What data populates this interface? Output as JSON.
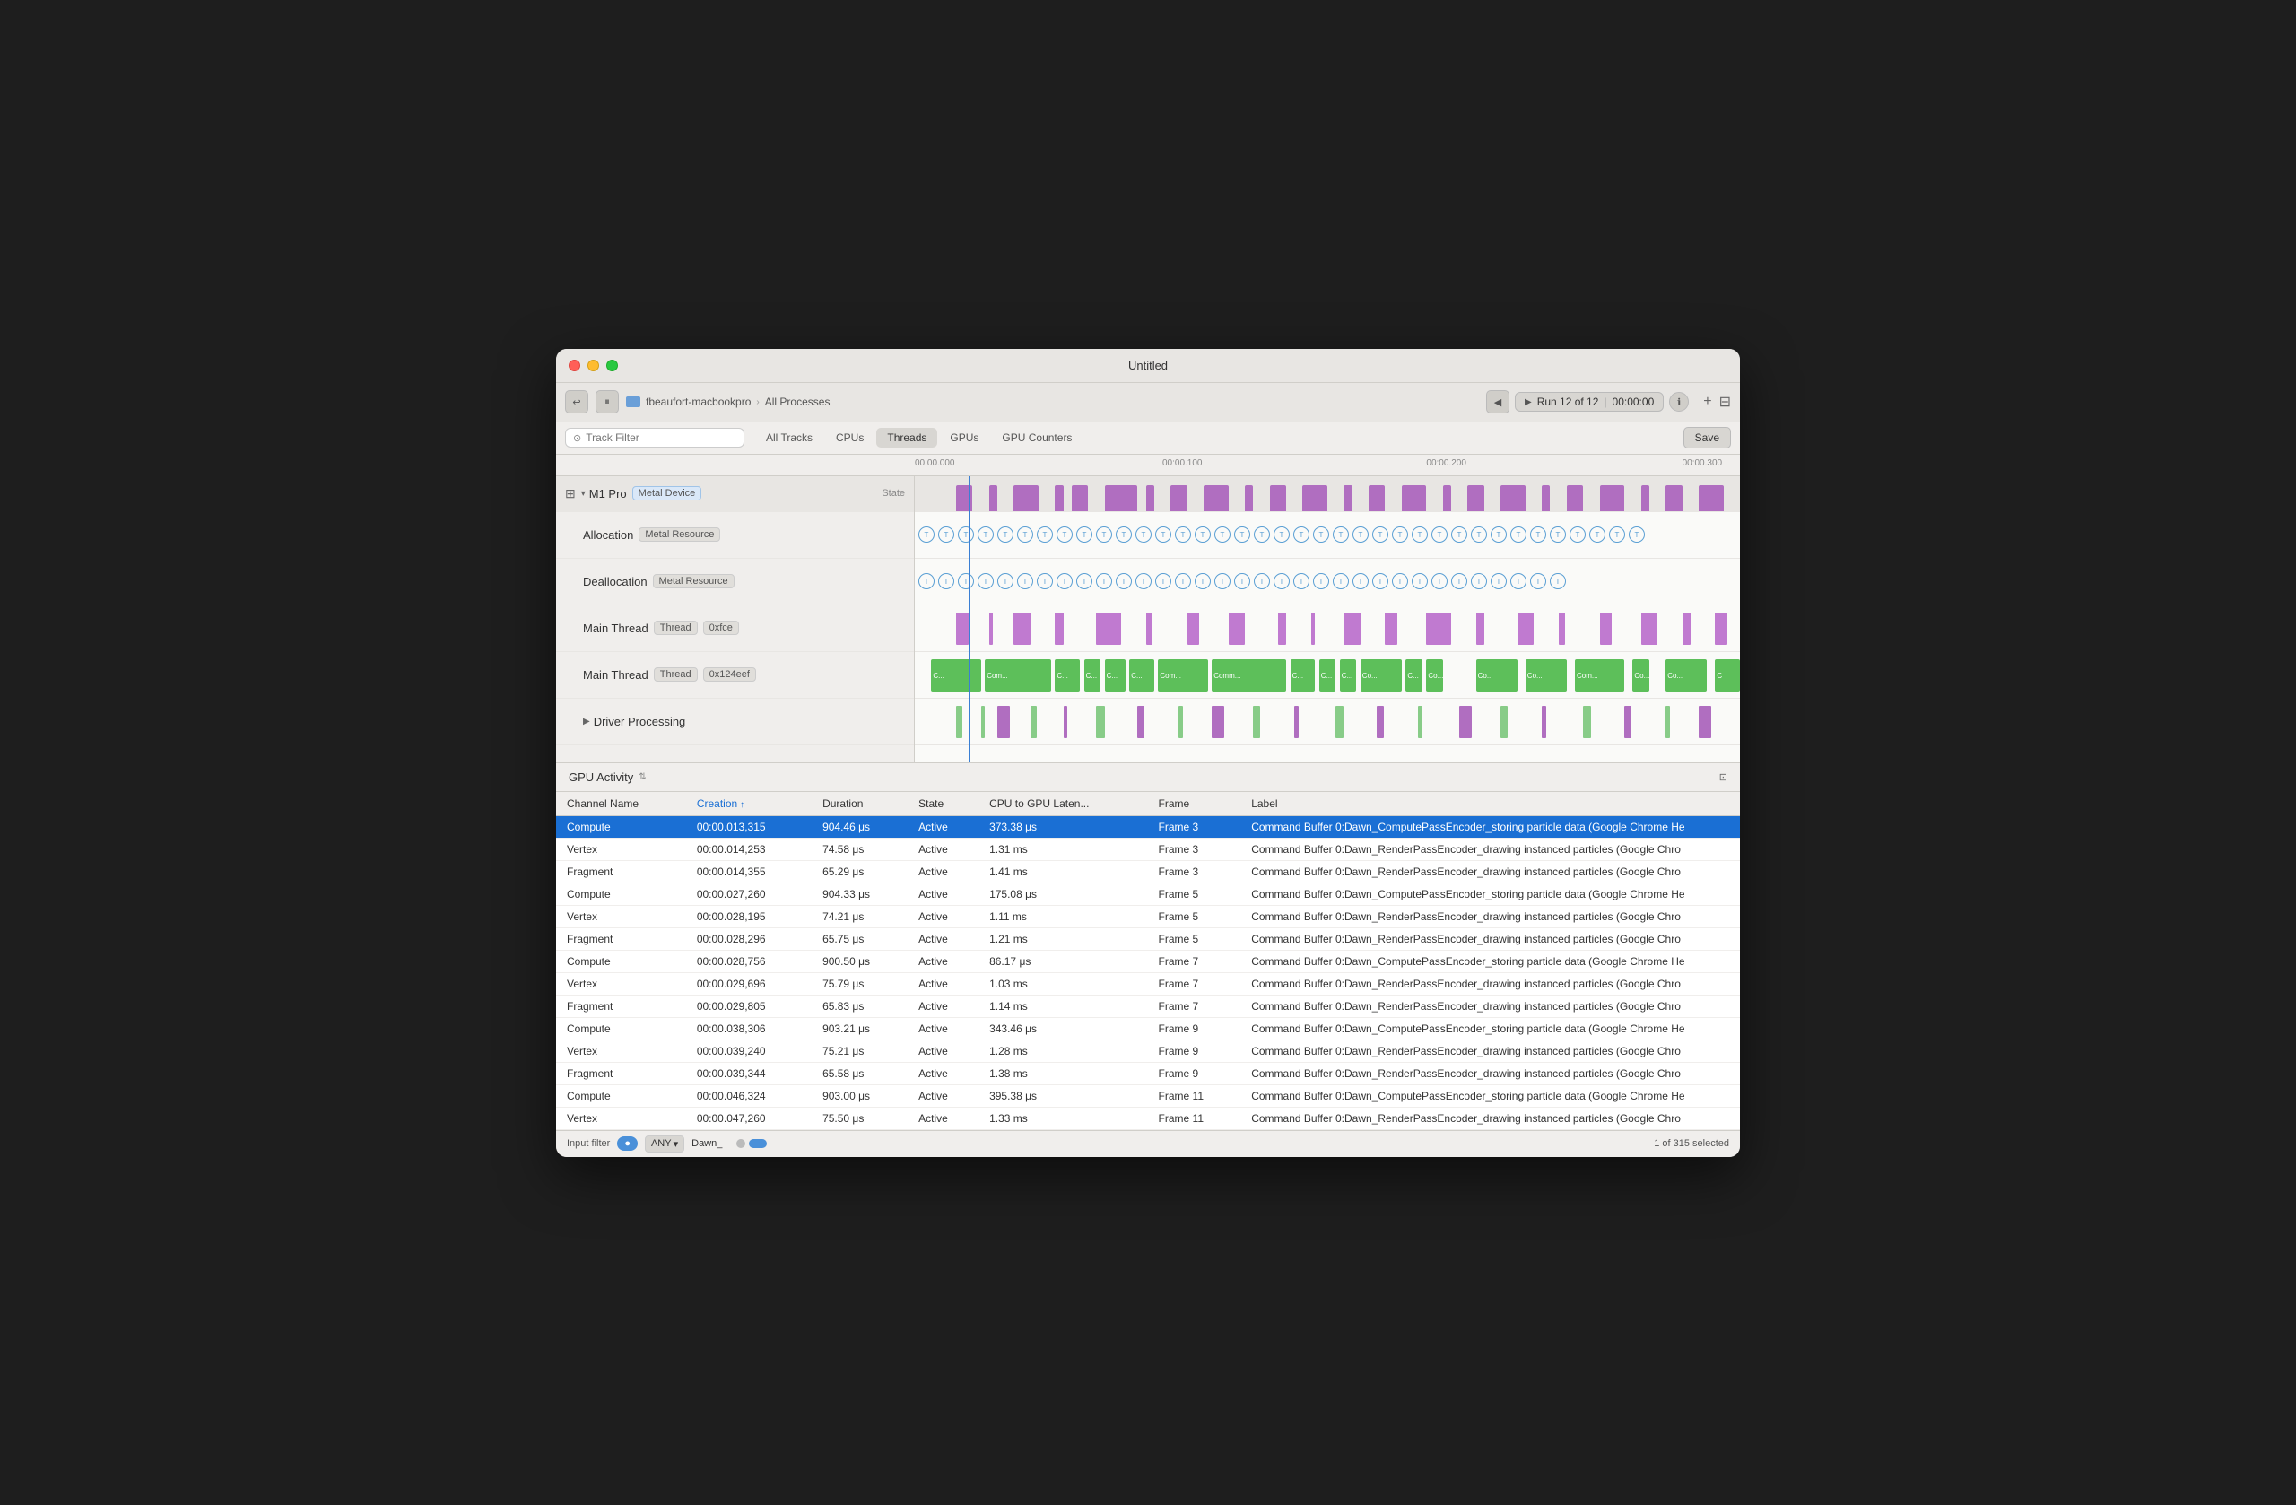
{
  "window": {
    "title": "Untitled"
  },
  "toolbar": {
    "device": "fbeaufort-macbookpro",
    "breadcrumb": "All Processes",
    "run_label": "Run 12 of 12",
    "run_time": "00:00:00",
    "save_label": "Save"
  },
  "tabs": {
    "track_filter_placeholder": "Track Filter",
    "items": [
      {
        "id": "all-tracks",
        "label": "All Tracks",
        "active": false
      },
      {
        "id": "cpus",
        "label": "CPUs",
        "active": false
      },
      {
        "id": "threads",
        "label": "Threads",
        "active": true
      },
      {
        "id": "gpus",
        "label": "GPUs",
        "active": false
      },
      {
        "id": "gpu-counters",
        "label": "GPU Counters",
        "active": false
      }
    ]
  },
  "timeline": {
    "marks": [
      {
        "label": "00:00.000",
        "pos": 0
      },
      {
        "label": "00:00.100",
        "pos": 33
      },
      {
        "label": "00:00.200",
        "pos": 66
      },
      {
        "label": "00:00.300",
        "pos": 96
      }
    ]
  },
  "tracks": [
    {
      "id": "m1-pro",
      "name": "M1 Pro",
      "type": "header",
      "badge": "Metal Device",
      "badge_type": "blue",
      "state_label": "State",
      "viz_type": "purple_blocks"
    },
    {
      "id": "allocation",
      "name": "Allocation",
      "type": "sub",
      "badge": "Metal Resource",
      "viz_type": "circles"
    },
    {
      "id": "deallocation",
      "name": "Deallocation",
      "type": "sub",
      "badge": "Metal Resource",
      "viz_type": "circles"
    },
    {
      "id": "main-thread-1",
      "name": "Main Thread",
      "type": "sub",
      "badge": "Thread",
      "badge2": "0xfce",
      "viz_type": "purple_bars"
    },
    {
      "id": "main-thread-2",
      "name": "Main Thread",
      "type": "sub",
      "badge": "Thread",
      "badge2": "0x124eef",
      "viz_type": "green_bar"
    },
    {
      "id": "driver-processing",
      "name": "Driver Processing",
      "type": "sub",
      "viz_type": "mixed_bars"
    }
  ],
  "gpu_activity": {
    "title": "GPU Activity",
    "columns": [
      {
        "id": "channel",
        "label": "Channel Name"
      },
      {
        "id": "creation",
        "label": "Creation",
        "sorted": true
      },
      {
        "id": "duration",
        "label": "Duration"
      },
      {
        "id": "state",
        "label": "State"
      },
      {
        "id": "cpu_gpu_latency",
        "label": "CPU to GPU Laten..."
      },
      {
        "id": "frame",
        "label": "Frame"
      },
      {
        "id": "label",
        "label": "Label"
      }
    ],
    "rows": [
      {
        "channel": "Compute",
        "creation": "00:00.013,315",
        "duration": "904.46 μs",
        "state": "Active",
        "latency": "373.38 μs",
        "frame": "Frame 3",
        "label": "Command Buffer 0:Dawn_ComputePassEncoder_storing particle data   (Google Chrome He",
        "selected": true
      },
      {
        "channel": "Vertex",
        "creation": "00:00.014,253",
        "duration": "74.58 μs",
        "state": "Active",
        "latency": "1.31 ms",
        "frame": "Frame 3",
        "label": "Command Buffer 0:Dawn_RenderPassEncoder_drawing instanced particles   (Google Chro"
      },
      {
        "channel": "Fragment",
        "creation": "00:00.014,355",
        "duration": "65.29 μs",
        "state": "Active",
        "latency": "1.41 ms",
        "frame": "Frame 3",
        "label": "Command Buffer 0:Dawn_RenderPassEncoder_drawing instanced particles   (Google Chro"
      },
      {
        "channel": "Compute",
        "creation": "00:00.027,260",
        "duration": "904.33 μs",
        "state": "Active",
        "latency": "175.08 μs",
        "frame": "Frame 5",
        "label": "Command Buffer 0:Dawn_ComputePassEncoder_storing particle data   (Google Chrome He"
      },
      {
        "channel": "Vertex",
        "creation": "00:00.028,195",
        "duration": "74.21 μs",
        "state": "Active",
        "latency": "1.11 ms",
        "frame": "Frame 5",
        "label": "Command Buffer 0:Dawn_RenderPassEncoder_drawing instanced particles   (Google Chro"
      },
      {
        "channel": "Fragment",
        "creation": "00:00.028,296",
        "duration": "65.75 μs",
        "state": "Active",
        "latency": "1.21 ms",
        "frame": "Frame 5",
        "label": "Command Buffer 0:Dawn_RenderPassEncoder_drawing instanced particles   (Google Chro"
      },
      {
        "channel": "Compute",
        "creation": "00:00.028,756",
        "duration": "900.50 μs",
        "state": "Active",
        "latency": "86.17 μs",
        "frame": "Frame 7",
        "label": "Command Buffer 0:Dawn_ComputePassEncoder_storing particle data   (Google Chrome He"
      },
      {
        "channel": "Vertex",
        "creation": "00:00.029,696",
        "duration": "75.79 μs",
        "state": "Active",
        "latency": "1.03 ms",
        "frame": "Frame 7",
        "label": "Command Buffer 0:Dawn_RenderPassEncoder_drawing instanced particles   (Google Chro"
      },
      {
        "channel": "Fragment",
        "creation": "00:00.029,805",
        "duration": "65.83 μs",
        "state": "Active",
        "latency": "1.14 ms",
        "frame": "Frame 7",
        "label": "Command Buffer 0:Dawn_RenderPassEncoder_drawing instanced particles   (Google Chro"
      },
      {
        "channel": "Compute",
        "creation": "00:00.038,306",
        "duration": "903.21 μs",
        "state": "Active",
        "latency": "343.46 μs",
        "frame": "Frame 9",
        "label": "Command Buffer 0:Dawn_ComputePassEncoder_storing particle data   (Google Chrome He",
        "highlight_creation": true
      },
      {
        "channel": "Vertex",
        "creation": "00:00.039,240",
        "duration": "75.21 μs",
        "state": "Active",
        "latency": "1.28 ms",
        "frame": "Frame 9",
        "label": "Command Buffer 0:Dawn_RenderPassEncoder_drawing instanced particles   (Google Chro"
      },
      {
        "channel": "Fragment",
        "creation": "00:00.039,344",
        "duration": "65.58 μs",
        "state": "Active",
        "latency": "1.38 ms",
        "frame": "Frame 9",
        "label": "Command Buffer 0:Dawn_RenderPassEncoder_drawing instanced particles   (Google Chro"
      },
      {
        "channel": "Compute",
        "creation": "00:00.046,324",
        "duration": "903.00 μs",
        "state": "Active",
        "latency": "395.38 μs",
        "frame": "Frame 11",
        "label": "Command Buffer 0:Dawn_ComputePassEncoder_storing particle data   (Google Chrome He"
      },
      {
        "channel": "Vertex",
        "creation": "00:00.047,260",
        "duration": "75.50 μs",
        "state": "Active",
        "latency": "1.33 ms",
        "frame": "Frame 11",
        "label": "Command Buffer 0:Dawn_RenderPassEncoder_drawing instanced particles   (Google Chro"
      }
    ]
  },
  "statusbar": {
    "label": "Input filter",
    "filter_type": "ANY",
    "filter_value": "Dawn_",
    "selection": "1 of 315 selected"
  }
}
